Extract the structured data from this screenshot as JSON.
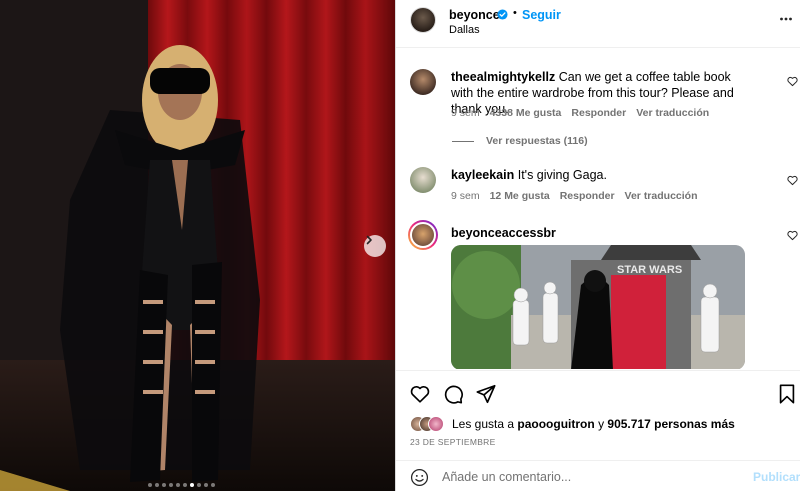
{
  "post": {
    "username": "beyonce",
    "verified": true,
    "separator": "•",
    "follow_label": "Seguir",
    "location": "Dallas",
    "media_count": 10,
    "media_active_index": 6
  },
  "comments": [
    {
      "username": "theealmightykellz",
      "text": "Can we get a coffee table book with the entire wardrobe from this tour? Please and thank you.",
      "time": "9 sem",
      "likes": "4338 Me gusta",
      "reply": "Responder",
      "translate": "Ver traducción",
      "replies_label": "Ver respuestas (116)"
    },
    {
      "username": "kayleekain",
      "text": "It's giving Gaga.",
      "time": "9 sem",
      "likes": "12 Me gusta",
      "reply": "Responder",
      "translate": "Ver traducción"
    },
    {
      "username": "beyonceaccessbr",
      "text": "",
      "sticker_sign": "STAR WARS"
    }
  ],
  "footer": {
    "likes_prefix": "Les gusta a",
    "liker": "paoooguitron",
    "likes_joiner": "y",
    "likes_count": "905.717 personas más",
    "date": "23 DE SEPTIEMBRE",
    "comment_placeholder": "Añade un comentario...",
    "publish_label": "Publicar"
  },
  "icons": {
    "verified": "verified-badge-icon",
    "more": "more-options-icon",
    "like": "heart-icon",
    "comment": "comment-icon",
    "share": "share-icon",
    "save": "bookmark-icon",
    "emoji": "emoji-icon",
    "next": "chevron-right-icon"
  },
  "colors": {
    "accent": "#0095f6",
    "muted": "#737373",
    "publish_disabled": "#b2dffc",
    "curtain": "#9c0f12"
  }
}
